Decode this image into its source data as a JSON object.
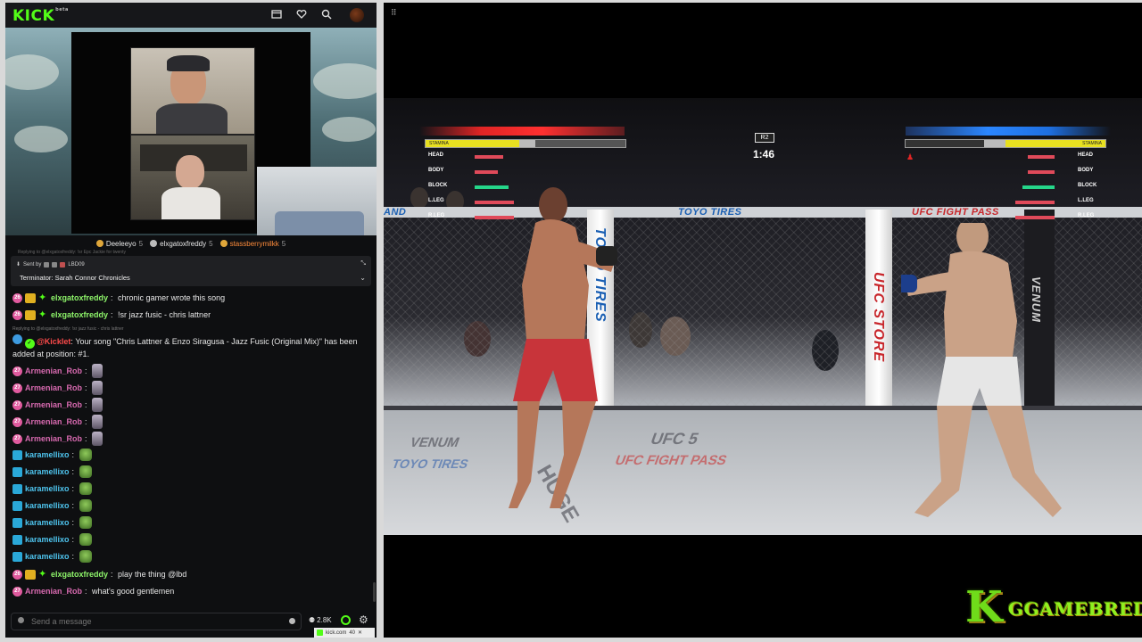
{
  "topbar": {
    "logo": "KICK",
    "logo_sup": "beta",
    "icons": [
      "theater-icon",
      "heart-icon",
      "search-icon",
      "avatar"
    ]
  },
  "subs": [
    {
      "name": "Deeleeyo",
      "count": "5",
      "style": "normal"
    },
    {
      "name": "elxgatoxfreddy",
      "count": "5",
      "style": "normal"
    },
    {
      "name": "stassberrymilkk",
      "count": "5",
      "style": "orange"
    }
  ],
  "reply_faint": "Replying to @elxgatoxfreddy: !sr Epc Jackie for twenty",
  "pinned": {
    "sent_by": "Sent by",
    "sent_by_user": "LBD09",
    "title": "Terminator: Sarah Connor Chronicles"
  },
  "chat": {
    "messages": [
      {
        "user": "elxgatoxfreddy",
        "sub": "26",
        "text": "chronic gamer wrote this song"
      },
      {
        "user": "elxgatoxfreddy",
        "sub": "26",
        "text": "!sr jazz fusic - chris lattner"
      },
      {
        "replying": "Replying to @elxgatoxfreddy: !sr jazz fusic - chris lattner"
      },
      {
        "user": "@Kicklet",
        "text": "Your song \"Chris Lattner & Enzo Siragusa - Jazz Fusic (Original Mix)\" has been added at position: #1."
      },
      {
        "user": "Armenian_Rob",
        "sub": "27"
      },
      {
        "user": "Armenian_Rob",
        "sub": "27"
      },
      {
        "user": "Armenian_Rob",
        "sub": "27"
      },
      {
        "user": "Armenian_Rob",
        "sub": "27"
      },
      {
        "user": "Armenian_Rob",
        "sub": "27"
      },
      {
        "user": "karamellixo"
      },
      {
        "user": "karamellixo"
      },
      {
        "user": "karamellixo"
      },
      {
        "user": "karamellixo"
      },
      {
        "user": "karamellixo"
      },
      {
        "user": "karamellixo"
      },
      {
        "user": "karamellixo"
      },
      {
        "user": "elxgatoxfreddy",
        "sub": "26",
        "text": "play the thing @lbd"
      },
      {
        "user": "Armenian_Rob",
        "sub": "27",
        "text": "what's good gentlemen"
      }
    ]
  },
  "input": {
    "placeholder": "Send a message",
    "viewers": "2.8K"
  },
  "tab_bar": {
    "url": "kick.com",
    "count": "40"
  },
  "game": {
    "hud": {
      "stamina_label": "STAMINA",
      "round": "R2",
      "timer": "1:46",
      "left_stats": [
        "HEAD",
        "BODY",
        "BLOCK",
        "L.LEG",
        "R.LEG"
      ],
      "right_stats": [
        "HEAD",
        "BODY",
        "BLOCK",
        "L.LEG",
        "R.LEG"
      ],
      "left_stamina_pct": 47,
      "right_stamina_pct": 50
    },
    "banners": {
      "rail_left": "AND",
      "rail_main": "TOYO TIRES",
      "rail_right": "UFC FIGHT PASS",
      "post_left": "TOYO TIRES",
      "post_right": "UFC STORE",
      "post_venum": "VENUM",
      "mat_1": "UFC 5",
      "mat_2": "UFC FIGHT PASS",
      "mat_3": "TOYO TIRES",
      "mat_4": "VENUM",
      "mat_5": "HUGE"
    }
  },
  "watermark": {
    "k": "K",
    "text": "GGAMEBRED"
  },
  "colors": {
    "kick_green": "#53fc18",
    "health_red": "#e02525",
    "health_blue": "#1e6fe0",
    "stamina_yellow": "#e8e020"
  }
}
